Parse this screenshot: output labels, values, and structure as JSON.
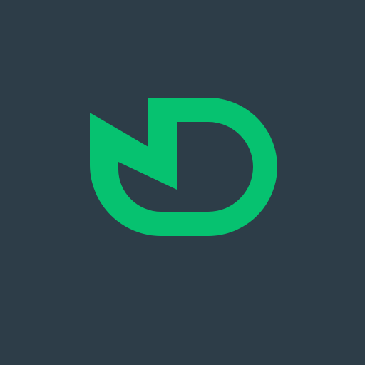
{
  "app": {
    "icon": "dn-monogram-logo",
    "colors": {
      "background": "#2d3d48",
      "accent": "#06c270"
    }
  }
}
